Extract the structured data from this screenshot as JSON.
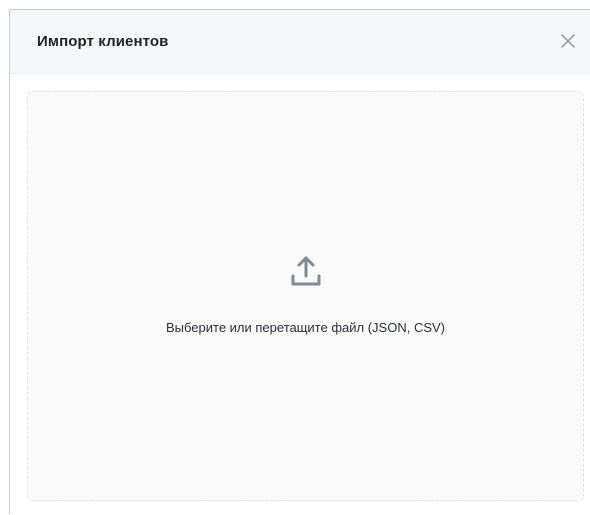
{
  "modal": {
    "title": "Импорт клиентов",
    "close_icon": "close-icon"
  },
  "dropzone": {
    "icon": "upload-icon",
    "text": "Выберите или перетащите файл (JSON, CSV)"
  },
  "colors": {
    "header_bg": "#f6f7f9",
    "dropzone_bg": "#fafafa",
    "dropzone_border": "#dfe2e6",
    "icon_color": "#7e8a99",
    "title_color": "#1f2329"
  }
}
